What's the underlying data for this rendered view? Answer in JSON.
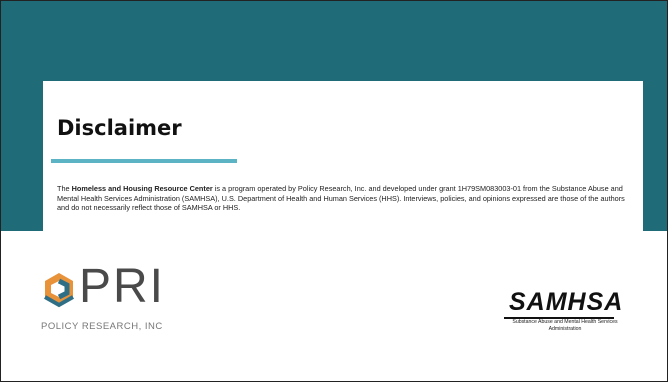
{
  "slide": {
    "title": "Disclaimer",
    "body": {
      "prefix": "The ",
      "bold": "Homeless and Housing Resource Center",
      "suffix": " is a program operated by Policy Research, Inc. and developed under grant 1H79SM083003-01 from the Substance Abuse and Mental Health Services Administration (SAMHSA), U.S. Department of Health and Human Services (HHS). Interviews, policies, and opinions expressed are those of the authors and do not necessarily reflect those of SAMHSA or HHS."
    }
  },
  "logos": {
    "pri": {
      "mark": "PRI",
      "subtitle": "POLICY RESEARCH, INC"
    },
    "samhsa": {
      "name": "SAMHSA",
      "subtitle": "Substance Abuse and Mental Health Services Administration"
    }
  },
  "colors": {
    "teal": "#1f6b78",
    "accent_rule": "#5cb3c4",
    "pri_orange": "#e8923a",
    "pri_blue": "#2f6f86"
  }
}
